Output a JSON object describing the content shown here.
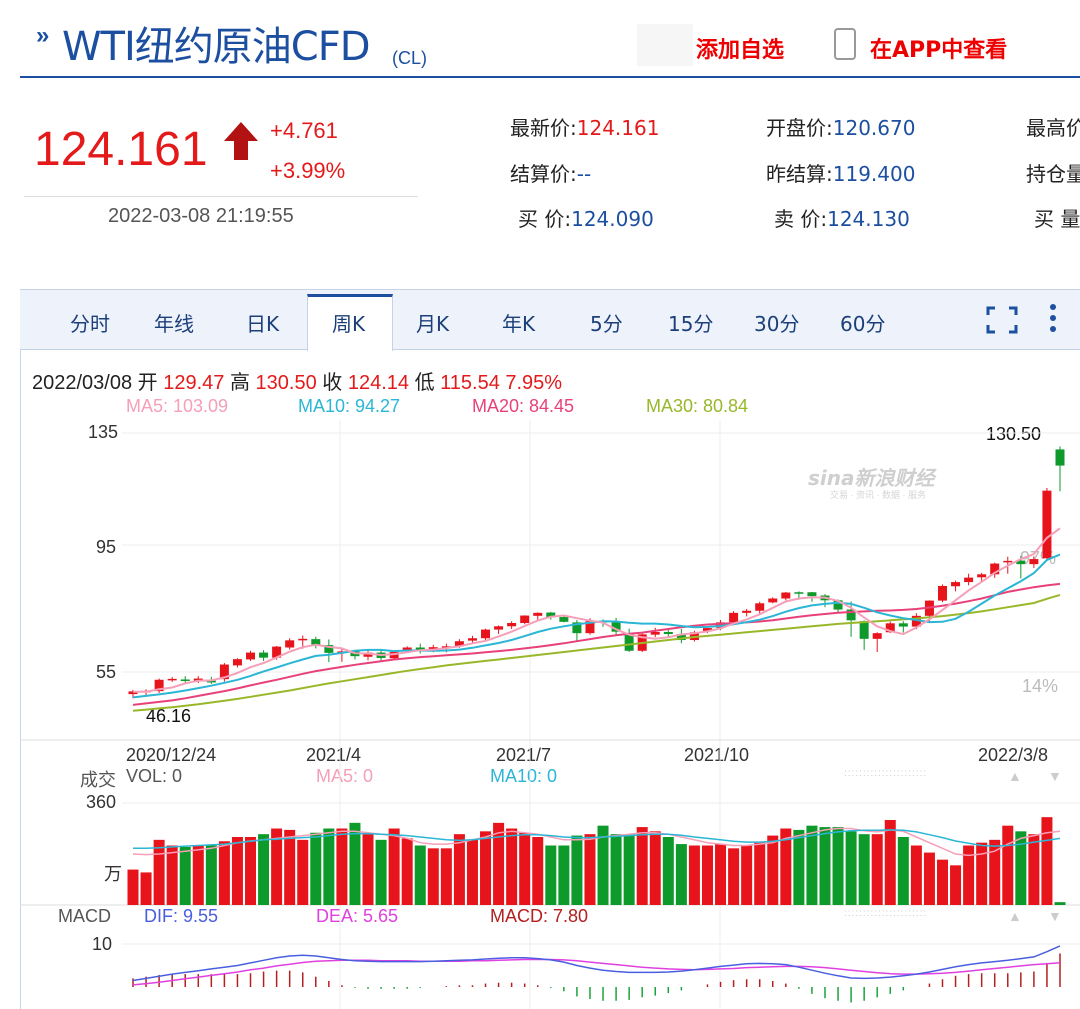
{
  "header": {
    "title_main": "WTI纽约原油CFD",
    "title_sub": "(CL)",
    "add_watch": "添加自选",
    "view_app": "在APP中查看"
  },
  "quote": {
    "price": "124.161",
    "change": "+4.761",
    "change_pct": "+3.99%",
    "time": "2022-03-08 21:19:55",
    "fields": {
      "latest_label": "最新价:",
      "latest_value": "124.161",
      "settle_label": "结算价:",
      "settle_value": "--",
      "bid_label": "买  价:",
      "bid_value": "124.090",
      "open_label": "开盘价:",
      "open_value": "120.670",
      "prev_settle_label": "昨结算:",
      "prev_settle_value": "119.400",
      "ask_label": "卖  价:",
      "ask_value": "124.130",
      "high_label_partial": "最高价",
      "oi_label_partial": "持仓量",
      "bid_vol_label_partial": "买  量"
    },
    "colors": {
      "up": "#e41a1a",
      "link": "#1c4fa0"
    }
  },
  "tabs": [
    "分时",
    "年线",
    "日K",
    "周K",
    "月K",
    "年K",
    "5分",
    "15分",
    "30分",
    "60分"
  ],
  "active_tab": "周K",
  "toolbar": {
    "fullscreen_icon": "fullscreen-icon",
    "menu_icon": "more-vert-icon"
  },
  "bar_info": {
    "date": "2022/03/08",
    "open_label": "开",
    "open": "129.47",
    "high_label": "高",
    "high": "130.50",
    "close_label": "收",
    "close": "124.14",
    "low_label": "低",
    "low": "115.54",
    "pct": "7.95%"
  },
  "ma_legend": [
    {
      "label": "MA5: 103.09",
      "color": "#f59fb8"
    },
    {
      "label": "MA10: 94.27",
      "color": "#2bb6d6"
    },
    {
      "label": "MA20: 84.45",
      "color": "#e8417a"
    },
    {
      "label": "MA30: 80.84",
      "color": "#98b82a"
    }
  ],
  "price_axis": {
    "labels": [
      "135",
      "95",
      "55"
    ],
    "pct_labels": [
      "97%",
      "14%"
    ],
    "max_label": "130.50",
    "min_label": "46.16"
  },
  "x_axis": [
    "2020/12/24",
    "2021/4",
    "2021/7",
    "2021/10",
    "2022/3/8"
  ],
  "watermark": {
    "brand": "sina新浪财经",
    "tagline": "交易 · 资讯 · 数据 · 服务"
  },
  "volume": {
    "label": "成交",
    "vol": "VOL: 0",
    "ma5": "MA5: 0",
    "ma10": "MA10: 0",
    "axis_max": "360",
    "unit": "万"
  },
  "macd": {
    "label": "MACD",
    "dif": "DIF: 9.55",
    "dea": "DEA: 5.65",
    "macd": "MACD: 7.80",
    "axis_label": "10"
  },
  "chart_data": {
    "type": "candlestick",
    "interval": "weekly",
    "x_start": "2020/12/24",
    "x_end": "2022/3/8",
    "ylim": [
      40,
      135
    ],
    "candles": [
      [
        47.6,
        48.5,
        46.2,
        49.0
      ],
      [
        48.2,
        48.7,
        47.2,
        49.2
      ],
      [
        48.6,
        52.4,
        48.0,
        52.8
      ],
      [
        52.4,
        52.7,
        51.7,
        53.3
      ],
      [
        52.5,
        52.3,
        51.5,
        53.6
      ],
      [
        52.1,
        52.8,
        51.3,
        53.6
      ],
      [
        52.1,
        51.5,
        51.0,
        53.4
      ],
      [
        52.6,
        57.5,
        51.8,
        58.0
      ],
      [
        57.2,
        59.3,
        56.5,
        59.6
      ],
      [
        59.2,
        61.5,
        58.7,
        62.1
      ],
      [
        61.5,
        59.8,
        58.7,
        62.3
      ],
      [
        59.8,
        63.5,
        59.1,
        63.7
      ],
      [
        63.2,
        65.6,
        62.5,
        66.3
      ],
      [
        65.6,
        66.1,
        62.8,
        67.2
      ],
      [
        66.0,
        64.0,
        62.9,
        66.8
      ],
      [
        64.0,
        61.4,
        58.3,
        65.9
      ],
      [
        61.4,
        61.9,
        58.4,
        62.8
      ],
      [
        62.0,
        60.3,
        59.2,
        62.3
      ],
      [
        60.1,
        61.5,
        58.9,
        62.6
      ],
      [
        61.5,
        59.7,
        58.5,
        62.3
      ],
      [
        59.6,
        61.7,
        59.4,
        62.0
      ],
      [
        62.0,
        63.2,
        61.4,
        63.6
      ],
      [
        63.2,
        62.5,
        61.2,
        64.5
      ],
      [
        62.4,
        63.3,
        61.6,
        64.1
      ],
      [
        63.3,
        63.6,
        61.6,
        64.5
      ],
      [
        63.6,
        65.3,
        63.1,
        66.0
      ],
      [
        65.5,
        66.3,
        64.8,
        67.1
      ],
      [
        66.3,
        69.2,
        65.5,
        69.5
      ],
      [
        69.2,
        70.3,
        67.7,
        70.6
      ],
      [
        70.3,
        71.4,
        69.4,
        72.0
      ],
      [
        71.4,
        73.9,
        71.0,
        74.0
      ],
      [
        73.8,
        74.8,
        72.3,
        75.0
      ],
      [
        74.9,
        73.3,
        72.5,
        75.1
      ],
      [
        73.4,
        71.8,
        71.6,
        74.0
      ],
      [
        71.6,
        68.0,
        65.0,
        72.4
      ],
      [
        68.0,
        72.0,
        67.5,
        73.0
      ],
      [
        72.1,
        71.6,
        70.1,
        72.6
      ],
      [
        71.6,
        68.5,
        67.5,
        73.1
      ],
      [
        68.0,
        62.1,
        61.7,
        69.5
      ],
      [
        62.1,
        67.6,
        61.7,
        68.0
      ],
      [
        67.5,
        68.4,
        66.7,
        69.8
      ],
      [
        68.4,
        67.7,
        66.4,
        69.1
      ],
      [
        67.7,
        65.7,
        64.6,
        69.4
      ],
      [
        65.7,
        68.3,
        65.2,
        68.8
      ],
      [
        68.6,
        69.7,
        68.0,
        70.1
      ],
      [
        69.8,
        71.6,
        69.0,
        72.4
      ],
      [
        71.7,
        74.8,
        71.2,
        75.4
      ],
      [
        74.8,
        75.5,
        73.6,
        76.1
      ],
      [
        75.5,
        78.0,
        74.0,
        78.5
      ],
      [
        78.3,
        79.6,
        78.0,
        80.0
      ],
      [
        79.6,
        81.6,
        79.0,
        81.8
      ],
      [
        81.7,
        81.2,
        79.2,
        82.0
      ],
      [
        81.7,
        80.4,
        78.5,
        81.8
      ],
      [
        80.6,
        79.0,
        76.7,
        81.1
      ],
      [
        79.0,
        75.9,
        75.0,
        79.3
      ],
      [
        75.9,
        72.3,
        66.8,
        78.6
      ],
      [
        72.0,
        66.1,
        62.4,
        72.3
      ],
      [
        66.1,
        68.0,
        61.7,
        68.3
      ],
      [
        68.3,
        71.3,
        68.1,
        71.9
      ],
      [
        71.3,
        70.2,
        68.2,
        72.0
      ],
      [
        70.2,
        73.8,
        69.3,
        74.7
      ],
      [
        73.8,
        78.9,
        71.8,
        79.0
      ],
      [
        78.9,
        83.8,
        78.4,
        84.3
      ],
      [
        83.7,
        85.1,
        82.0,
        85.6
      ],
      [
        85.1,
        86.6,
        84.0,
        87.9
      ],
      [
        86.7,
        87.7,
        85.2,
        88.2
      ],
      [
        87.7,
        91.3,
        86.5,
        91.6
      ],
      [
        91.7,
        92.2,
        87.9,
        93.6
      ],
      [
        92.3,
        91.1,
        86.3,
        93.9
      ],
      [
        91.1,
        92.8,
        89.8,
        93.7
      ],
      [
        93.1,
        115.7,
        92.5,
        116.6
      ],
      [
        129.5,
        124.1,
        115.5,
        130.5
      ]
    ],
    "ma5": [
      48.4,
      48.4,
      49.2,
      49.8,
      51.2,
      52.1,
      52.2,
      53.2,
      54.7,
      56.6,
      58.0,
      59.9,
      61.8,
      63.3,
      64.1,
      63.4,
      62.9,
      61.3,
      61.2,
      60.7,
      61.0,
      61.6,
      62.3,
      62.5,
      63.0,
      63.6,
      64.6,
      65.4,
      66.9,
      68.5,
      70.4,
      72.2,
      73.5,
      73.9,
      73.0,
      72.2,
      71.5,
      69.3,
      67.5,
      66.6,
      66.1,
      66.6,
      67.6,
      68.0,
      68.6,
      69.6,
      71.2,
      72.6,
      74.3,
      76.5,
      78.6,
      79.6,
      80.0,
      79.9,
      78.8,
      76.5,
      73.2,
      70.3,
      68.7,
      67.7,
      69.9,
      72.6,
      75.8,
      79.0,
      82.3,
      85.2,
      88.2,
      90.6,
      92.8,
      94.5,
      99.9,
      103.1
    ],
    "ma10": [
      46.5,
      47.0,
      47.5,
      48.1,
      48.8,
      49.6,
      50.4,
      51.4,
      52.4,
      53.7,
      55.2,
      56.5,
      57.9,
      59.2,
      60.4,
      60.8,
      61.4,
      62.1,
      62.4,
      62.4,
      62.0,
      62.2,
      62.2,
      62.1,
      62.2,
      62.5,
      63.1,
      63.9,
      64.7,
      65.7,
      67.0,
      68.4,
      69.5,
      70.3,
      71.0,
      71.5,
      72.0,
      71.9,
      71.5,
      71.2,
      71.2,
      70.9,
      70.4,
      70.0,
      70.1,
      70.4,
      71.0,
      71.7,
      72.5,
      73.7,
      75.2,
      76.4,
      77.3,
      77.8,
      78.2,
      77.8,
      76.5,
      75.0,
      73.9,
      73.0,
      72.4,
      71.7,
      71.8,
      72.8,
      75.2,
      77.9,
      80.6,
      83.0,
      85.4,
      88.1,
      92.5,
      94.3
    ],
    "ma20": [
      44.0,
      44.5,
      45.0,
      45.5,
      46.2,
      47.0,
      47.8,
      48.6,
      49.5,
      50.5,
      51.5,
      52.4,
      53.4,
      54.4,
      55.3,
      56.0,
      56.7,
      57.4,
      58.0,
      58.6,
      59.2,
      59.6,
      60.0,
      60.3,
      60.6,
      60.9,
      61.2,
      61.6,
      62.0,
      62.4,
      62.9,
      63.4,
      64.0,
      64.6,
      65.3,
      66.0,
      66.7,
      67.3,
      67.8,
      68.2,
      68.8,
      69.4,
      70.0,
      70.5,
      70.9,
      71.1,
      71.4,
      71.6,
      71.9,
      72.3,
      72.9,
      73.5,
      74.0,
      74.4,
      74.8,
      75.1,
      75.3,
      75.5,
      75.6,
      75.8,
      76.1,
      76.6,
      77.2,
      77.9,
      78.7,
      79.6,
      80.7,
      81.8,
      82.6,
      83.4,
      84.0,
      84.5
    ],
    "ma30": [
      42.0,
      42.4,
      42.8,
      43.2,
      43.7,
      44.2,
      44.8,
      45.4,
      46.0,
      46.7,
      47.4,
      48.1,
      48.8,
      49.6,
      50.4,
      51.2,
      51.9,
      52.6,
      53.3,
      54.0,
      54.7,
      55.4,
      56.0,
      56.6,
      57.2,
      57.7,
      58.2,
      58.7,
      59.2,
      59.7,
      60.2,
      60.7,
      61.2,
      61.7,
      62.2,
      62.7,
      63.2,
      63.7,
      64.2,
      64.7,
      65.2,
      65.7,
      66.2,
      66.7,
      67.1,
      67.5,
      67.9,
      68.3,
      68.7,
      69.1,
      69.5,
      69.9,
      70.3,
      70.7,
      71.1,
      71.4,
      71.7,
      72.0,
      72.3,
      72.6,
      72.9,
      73.3,
      73.7,
      74.2,
      74.7,
      75.3,
      76.0,
      76.7,
      77.4,
      78.1,
      79.5,
      80.8
    ],
    "volume": [
      125,
      115,
      230,
      210,
      205,
      210,
      210,
      225,
      240,
      240,
      250,
      270,
      265,
      230,
      255,
      270,
      270,
      290,
      250,
      230,
      270,
      235,
      210,
      200,
      200,
      250,
      230,
      260,
      290,
      270,
      255,
      240,
      210,
      210,
      245,
      250,
      280,
      250,
      250,
      275,
      260,
      240,
      215,
      210,
      210,
      215,
      200,
      210,
      220,
      245,
      270,
      265,
      280,
      275,
      275,
      260,
      250,
      250,
      300,
      240,
      210,
      185,
      160,
      140,
      210,
      220,
      230,
      280,
      260,
      250,
      310,
      10
    ],
    "volume_ma5": [
      180,
      178,
      180,
      185,
      190,
      195,
      200,
      210,
      220,
      226,
      230,
      235,
      240,
      245,
      250,
      255,
      260,
      260,
      255,
      250,
      245,
      235,
      220,
      215,
      215,
      220,
      230,
      240,
      255,
      260,
      255,
      250,
      240,
      230,
      230,
      232,
      240,
      245,
      250,
      255,
      255,
      250,
      240,
      230,
      220,
      215,
      210,
      210,
      215,
      220,
      235,
      245,
      255,
      265,
      270,
      270,
      262,
      258,
      265,
      260,
      240,
      220,
      200,
      180,
      175,
      180,
      190,
      215,
      235,
      245,
      255,
      260
    ],
    "volume_ma10": [
      200,
      200,
      202,
      205,
      208,
      210,
      212,
      215,
      220,
      225,
      230,
      232,
      235,
      238,
      240,
      245,
      250,
      252,
      252,
      250,
      248,
      245,
      240,
      235,
      230,
      228,
      230,
      235,
      240,
      245,
      248,
      248,
      245,
      240,
      238,
      238,
      240,
      242,
      245,
      248,
      250,
      250,
      246,
      240,
      235,
      230,
      225,
      222,
      222,
      225,
      230,
      238,
      245,
      252,
      258,
      262,
      264,
      264,
      265,
      264,
      258,
      248,
      238,
      226,
      218,
      210,
      208,
      210,
      215,
      222,
      228,
      235
    ],
    "macd_dif": [
      1.5,
      2.0,
      2.5,
      3.0,
      3.4,
      3.8,
      4.2,
      4.6,
      5.0,
      5.6,
      6.2,
      6.8,
      7.2,
      7.4,
      7.2,
      6.8,
      6.4,
      6.1,
      6.0,
      5.9,
      5.9,
      5.9,
      5.9,
      6.0,
      6.1,
      6.2,
      6.3,
      6.5,
      6.7,
      6.8,
      6.8,
      6.6,
      6.3,
      5.8,
      5.0,
      4.4,
      3.9,
      3.6,
      3.4,
      3.4,
      3.4,
      3.5,
      3.7,
      4.0,
      4.4,
      4.8,
      5.1,
      5.4,
      5.5,
      5.4,
      5.2,
      4.6,
      3.9,
      3.2,
      2.6,
      2.1,
      2.0,
      2.1,
      2.3,
      2.6,
      3.0,
      3.5,
      4.1,
      4.7,
      5.2,
      5.6,
      5.9,
      6.2,
      6.6,
      7.0,
      8.2,
      9.55
    ],
    "macd_dea": [
      0.5,
      0.8,
      1.1,
      1.5,
      1.9,
      2.3,
      2.7,
      3.1,
      3.5,
      4.0,
      4.4,
      4.9,
      5.3,
      5.7,
      6.0,
      6.1,
      6.2,
      6.2,
      6.2,
      6.1,
      6.1,
      6.1,
      6.0,
      6.0,
      6.0,
      6.0,
      6.1,
      6.1,
      6.2,
      6.3,
      6.4,
      6.4,
      6.4,
      6.3,
      6.1,
      5.8,
      5.5,
      5.2,
      4.9,
      4.6,
      4.4,
      4.2,
      4.1,
      4.0,
      4.1,
      4.2,
      4.3,
      4.5,
      4.6,
      4.7,
      4.8,
      4.8,
      4.7,
      4.5,
      4.2,
      3.9,
      3.6,
      3.3,
      3.1,
      3.0,
      3.0,
      3.1,
      3.2,
      3.4,
      3.7,
      4.0,
      4.3,
      4.6,
      4.9,
      5.2,
      5.4,
      5.65
    ],
    "macd_hist": [
      2.0,
      2.4,
      2.8,
      3.0,
      3.0,
      3.0,
      3.0,
      3.0,
      3.0,
      3.2,
      3.6,
      3.8,
      3.8,
      3.4,
      2.4,
      1.4,
      0.4,
      -0.2,
      -0.4,
      -0.4,
      -0.4,
      -0.4,
      -0.2,
      0,
      0.2,
      0.4,
      0.4,
      0.8,
      1.0,
      1.0,
      0.8,
      0.4,
      -0.2,
      -1.0,
      -2.2,
      -2.8,
      -3.2,
      -3.2,
      -3.0,
      -2.4,
      -2.0,
      -1.4,
      -0.8,
      0,
      0.6,
      1.2,
      1.6,
      1.8,
      1.8,
      1.4,
      0.8,
      -0.4,
      -1.6,
      -2.6,
      -3.2,
      -3.6,
      -3.2,
      -2.4,
      -1.6,
      -0.8,
      0,
      0.8,
      1.8,
      2.6,
      3.0,
      3.2,
      3.2,
      3.2,
      3.4,
      3.6,
      5.6,
      7.8
    ]
  }
}
